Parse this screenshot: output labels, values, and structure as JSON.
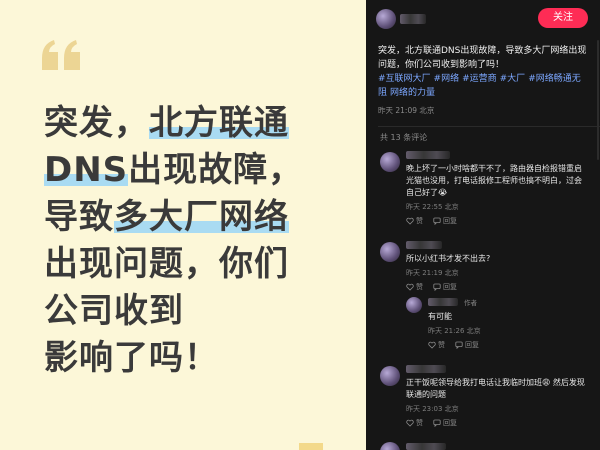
{
  "card": {
    "headline_lines": [
      {
        "pre": "突发，",
        "mark": "北方联通",
        "post": ""
      },
      {
        "pre": "",
        "mark": "DNS",
        "post": "出现故障，"
      },
      {
        "pre": "导致",
        "mark": "多大厂网络",
        "post": ""
      },
      {
        "pre": "出现问题，你们",
        "mark": "",
        "post": ""
      },
      {
        "pre": "公司收到",
        "mark": "",
        "post": ""
      },
      {
        "pre": "影响了吗！",
        "mark": "",
        "post": ""
      }
    ],
    "accent_color": "#a9dbf2",
    "bg_color": "#fcf7d8"
  },
  "panel": {
    "follow_label": "关注",
    "post_text": "突发，北方联通DNS出现故障，导致多大厂网络出现问题，你们公司收到影响了吗！",
    "tags": [
      "#互联网大厂",
      "#网络",
      "#运营商",
      "#大厂",
      "#网络畅通无阻",
      "网络的力量"
    ],
    "post_meta": "昨天 21:09 北京",
    "comment_count": "共 13 条评论",
    "comments": [
      {
        "text": "晚上坏了一小时啥都干不了，路由器自检报错重启光猫也没用，打电话报修工程师也搞不明白，过会自己好了😭",
        "meta": "昨天 22:55 北京",
        "like": "赞",
        "reply": "回复"
      },
      {
        "text": "所以小红书才发不出去?",
        "meta": "昨天 21:19 北京",
        "like": "赞",
        "reply": "回复"
      },
      {
        "author_tag": "作者",
        "text": "有可能",
        "meta": "昨天 21:26 北京",
        "like": "赞",
        "reply": "回复"
      },
      {
        "text": "正干饭呢领导给我打电话让我临时加班😩 然后发现联通的问题",
        "meta": "昨天 23:03 北京",
        "like": "赞",
        "reply": "回复"
      }
    ]
  }
}
